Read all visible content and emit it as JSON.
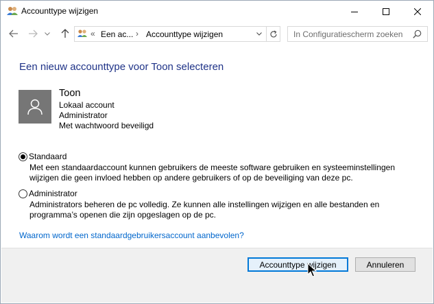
{
  "window": {
    "title": "Accounttype wijzigen",
    "controls": {
      "minimize": "minimize-icon",
      "maximize": "maximize-icon",
      "close": "close-icon"
    }
  },
  "nav": {
    "back_icon": "arrow-left-icon",
    "forward_icon": "arrow-right-icon",
    "recent_icon": "chevron-down-icon",
    "up_icon": "arrow-up-icon",
    "address": {
      "overflow": "«",
      "crumb1": "Een ac...",
      "separator": "›",
      "crumb2": "Accounttype wijzigen",
      "dropdown_icon": "chevron-down-icon",
      "refresh_icon": "refresh-icon"
    },
    "search": {
      "placeholder": "In Configuratiescherm zoeken",
      "value": ""
    }
  },
  "main": {
    "heading": "Een nieuw accounttype voor Toon selecteren",
    "user": {
      "name": "Toon",
      "lines": [
        "Lokaal account",
        "Administrator",
        "Met wachtwoord beveiligd"
      ]
    },
    "options": [
      {
        "label": "Standaard",
        "checked": true,
        "description": [
          "Met een standaardaccount kunnen gebruikers de meeste software gebruiken en systeeminstellingen",
          "wijzigen die geen invloed hebben op andere gebruikers of op de beveiliging van deze pc."
        ]
      },
      {
        "label": "Administrator",
        "checked": false,
        "description": [
          "Administrators beheren de pc volledig. Ze kunnen alle instellingen wijzigen en alle bestanden en",
          "programma’s openen die zijn opgeslagen op de pc."
        ]
      }
    ],
    "help_link": "Waarom wordt een standaardgebruikersaccount aanbevolen?"
  },
  "footer": {
    "primary_label": "Accounttype wijzigen",
    "cancel_label": "Annuleren"
  },
  "colors": {
    "heading": "#1e3287",
    "link": "#0066cc",
    "accent": "#0078d7",
    "avatar_bg": "#767676"
  }
}
